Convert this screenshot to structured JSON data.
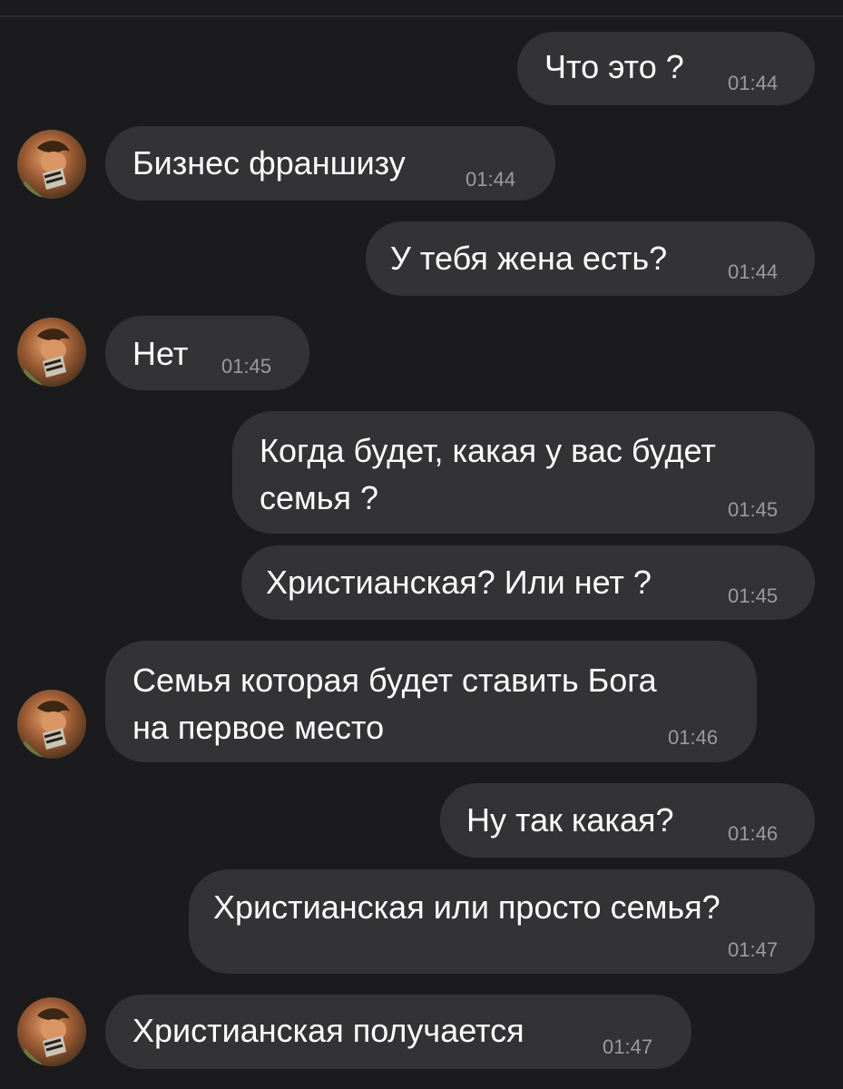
{
  "messages": [
    {
      "side": "out",
      "text": "Что это ?",
      "time": "01:44"
    },
    {
      "side": "in",
      "text": "Бизнес франшизу",
      "time": "01:44"
    },
    {
      "side": "out",
      "text": "У тебя жена есть?",
      "time": "01:44"
    },
    {
      "side": "in",
      "text": "Нет",
      "time": "01:45"
    },
    {
      "side": "out",
      "text_line1": "Когда будет, какая у вас будет",
      "text_line2": "семья ?",
      "time": "01:45"
    },
    {
      "side": "out",
      "text": "Христианская? Или нет ?",
      "time": "01:45"
    },
    {
      "side": "in",
      "text_line1": "Семья которая будет ставить Бога",
      "text_line2": "на первое место",
      "time": "01:46"
    },
    {
      "side": "out",
      "text": "Ну так какая?",
      "time": "01:46"
    },
    {
      "side": "out",
      "text": "Христианская или просто семья?",
      "time": "01:47"
    },
    {
      "side": "in",
      "text": "Христианская получается",
      "time": "01:47"
    }
  ],
  "colors": {
    "background": "#1b1b1d",
    "bubble": "#333335",
    "text": "#ffffff",
    "time": "#9b9ba0"
  },
  "icons": {
    "contact_avatar": "avatar-icon"
  }
}
